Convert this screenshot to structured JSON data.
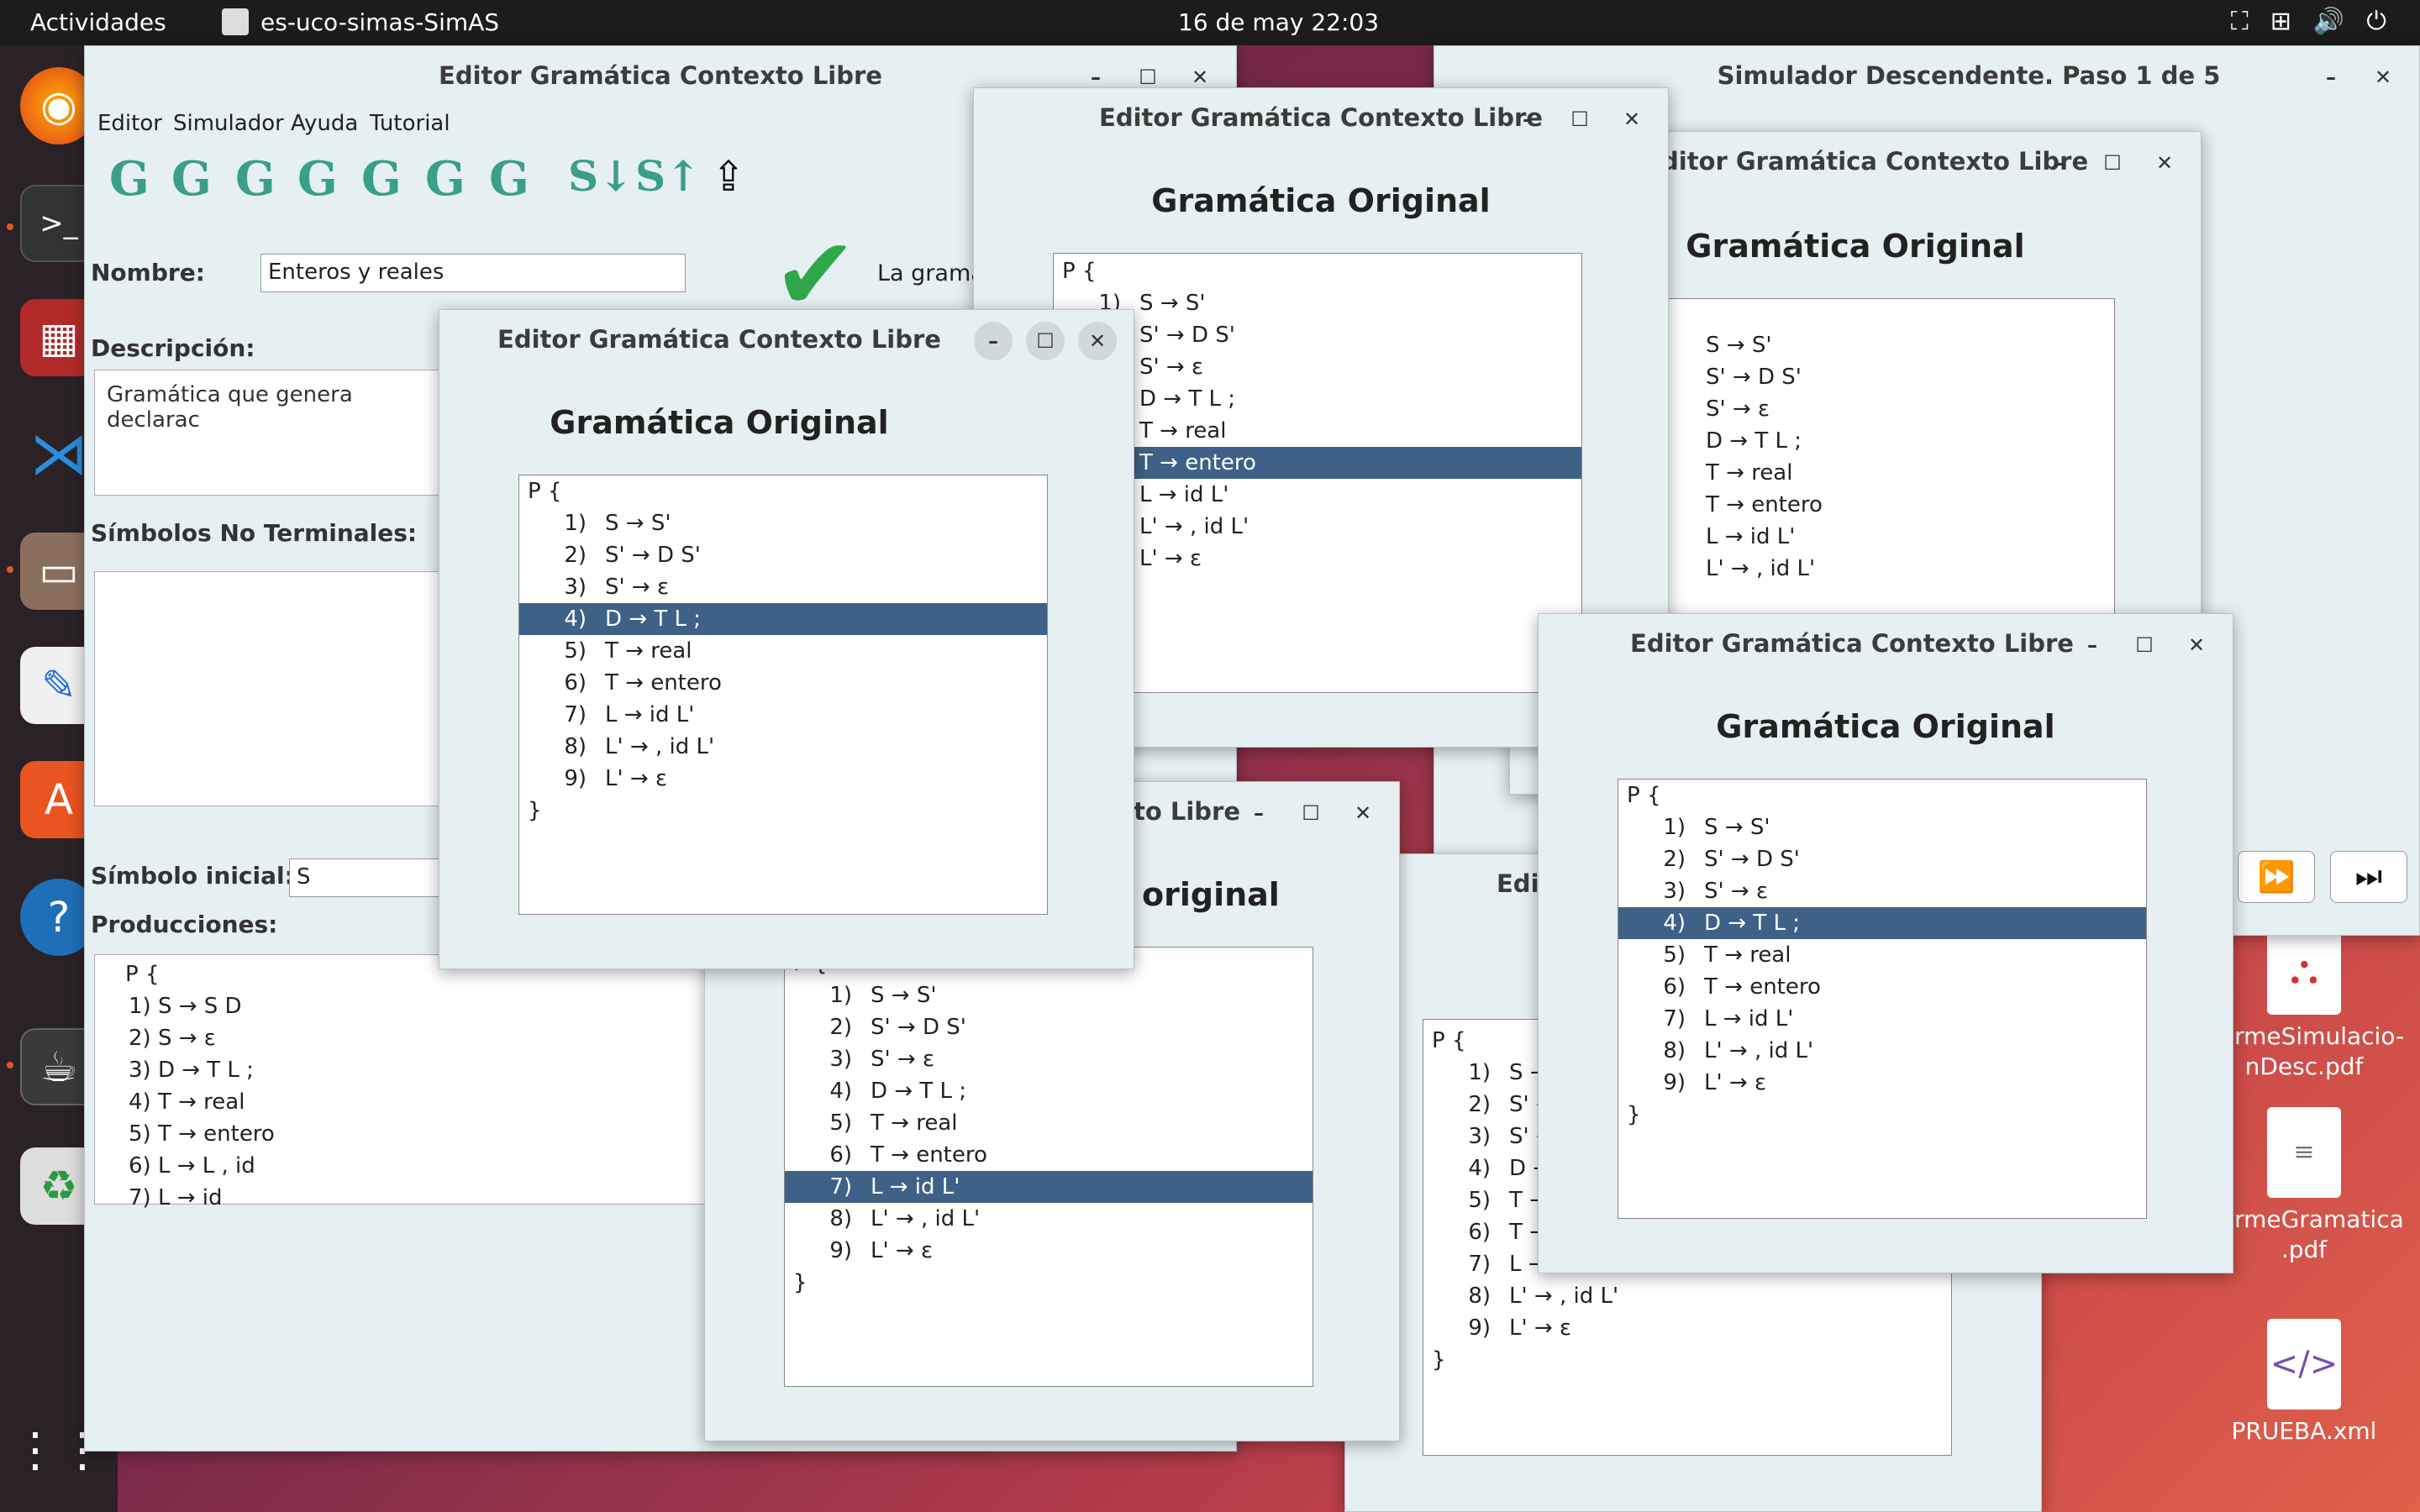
{
  "topbar": {
    "activities": "Actividades",
    "app_name": "es-uco-simas-SimAS",
    "clock": "16 de may  22:03",
    "tray_icons": [
      "accessibility-icon",
      "network-icon",
      "volume-icon",
      "power-icon"
    ]
  },
  "dock": {
    "apps": [
      "firefox-icon",
      "terminal-icon",
      "screenshot-icon",
      "vscode-icon",
      "files-icon",
      "text-editor-icon",
      "software-store-icon",
      "help-icon",
      "java-app-icon",
      "trash-icon",
      "app-grid-icon"
    ]
  },
  "desktop": {
    "icons": [
      {
        "label": "ormeSimulacio-\nnDesc.pdf"
      },
      {
        "label": "ormeGramatica\n.pdf"
      },
      {
        "label": "PRUEBA.xml"
      }
    ]
  },
  "main_editor": {
    "title": "Editor Gramática Contexto Libre",
    "menu": [
      "Editor",
      "Simulador",
      "Ayuda",
      "Tutorial"
    ],
    "toolbar": [
      "G",
      "G",
      "G",
      "G",
      "G",
      "G",
      "G",
      "S↓",
      "S↑"
    ],
    "nombre_label": "Nombre:",
    "nombre_value": "Enteros y reales",
    "valid_text": "La gramá",
    "descripcion_label": "Descripción:",
    "descripcion_value": "Gramática que genera declarac",
    "no_terminales_label": "Símbolos No Terminales:",
    "simbolo_inicial_label": "Símbolo inicial:",
    "simbolo_inicial_value": "S",
    "producciones_label": "Producciones:",
    "productions": [
      "P {",
      "1)   S → S D",
      "2)   S → ε",
      "3)   D → T L ;",
      "4)   T → real",
      "5)   T → entero",
      "6)   L → L , id",
      "7)   L → id"
    ]
  },
  "simulator": {
    "title": "Simulador Descendente. Paso 1 de 5"
  },
  "dialog_common": {
    "title": "Editor Gramática Contexto Libre",
    "heading": "Gramática Original",
    "open": "P {",
    "close": "}",
    "productions": [
      {
        "n": "1)",
        "r": "S → S'"
      },
      {
        "n": "2)",
        "r": "S' → D S'"
      },
      {
        "n": "3)",
        "r": "S' → ε"
      },
      {
        "n": "4)",
        "r": "D → T L ;"
      },
      {
        "n": "5)",
        "r": "T → real"
      },
      {
        "n": "6)",
        "r": "T → entero"
      },
      {
        "n": "7)",
        "r": "L → id L'"
      },
      {
        "n": "8)",
        "r": "L' → , id L'"
      },
      {
        "n": "9)",
        "r": "L' → ε"
      }
    ]
  },
  "dialogs": [
    {
      "id": "front",
      "selected": 4
    },
    {
      "id": "top-center",
      "selected": 6
    },
    {
      "id": "top-right",
      "selected": 0
    },
    {
      "id": "right",
      "selected": 4
    },
    {
      "id": "bottom-center",
      "selected": 7
    },
    {
      "id": "bottom-right",
      "selected": 0
    }
  ],
  "partial_texts": {
    "to_libre": "to Libre",
    "original_tail": "original",
    "edit_head": "Edit",
    "top_right_title": "ditor Gramática Contexto Libre"
  }
}
